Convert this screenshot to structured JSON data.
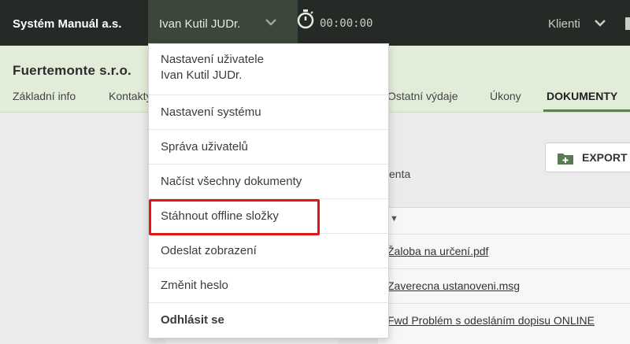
{
  "topbar": {
    "brand": "Systém Manuál a.s.",
    "user_name": "Ivan Kutil JUDr.",
    "timer": "00:00:00",
    "clients_label": "Klienti"
  },
  "client": {
    "name": "Fuertemonte s.r.o.",
    "tabs": [
      {
        "label": "Základní info"
      },
      {
        "label": "Kontakty"
      },
      {
        "label": "Ostatní výdaje"
      },
      {
        "label": "Úkony"
      },
      {
        "label": "DOKUMENTY",
        "active": true
      }
    ]
  },
  "content": {
    "export_label": "EXPORT",
    "hint_text": "enta",
    "documents": [
      {
        "name": "Žaloba na určení.pdf"
      },
      {
        "name": "Zaverecna ustanoveni.msg"
      },
      {
        "name": "Fwd Problém s odesláním dopisu ONLINE"
      }
    ]
  },
  "user_dropdown": {
    "items": [
      {
        "label": "Nastavení uživatele",
        "sub": "Ivan Kutil JUDr."
      },
      {
        "label": "Nastavení systému"
      },
      {
        "label": "Správa uživatelů"
      },
      {
        "label": "Načíst všechny dokumenty"
      },
      {
        "label": "Stáhnout offline složky",
        "highlighted": true
      },
      {
        "label": "Odeslat zobrazení"
      },
      {
        "label": "Změnit heslo"
      },
      {
        "label": "Odhlásit se",
        "bold": true
      }
    ],
    "highlight_color": "#e01616"
  },
  "colors": {
    "topbar": "#262a26",
    "user_menu": "#3c463a",
    "client_header": "#e2edd9",
    "accent": "#4f8a3d"
  }
}
